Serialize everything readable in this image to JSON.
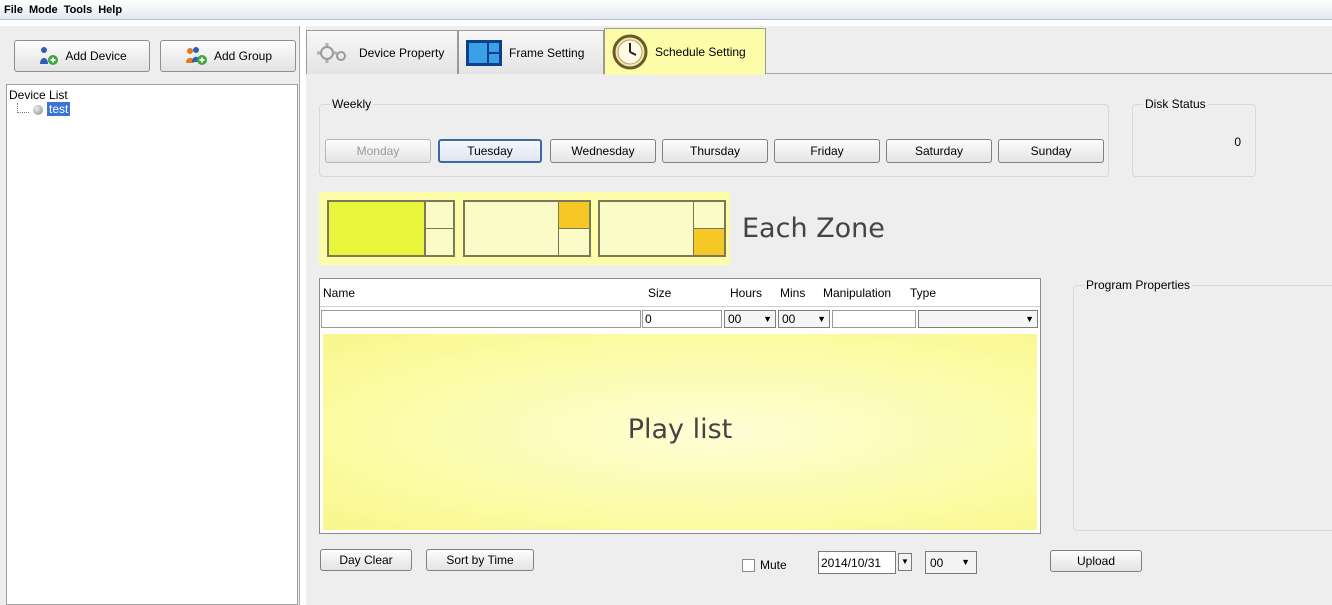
{
  "menu": {
    "items": [
      "File",
      "Mode",
      "Tools",
      "Help"
    ]
  },
  "left": {
    "add_device": "Add Device",
    "add_group": "Add Group",
    "device_list_title": "Device List",
    "devices": [
      "test"
    ]
  },
  "tabs": [
    {
      "label": "Device Property",
      "icon": "gear-icon"
    },
    {
      "label": "Frame Setting",
      "icon": "frame-layout-icon"
    },
    {
      "label": "Schedule Setting",
      "icon": "clock-icon"
    }
  ],
  "weekly": {
    "title": "Weekly",
    "days": [
      "Monday",
      "Tuesday",
      "Wednesday",
      "Thursday",
      "Friday",
      "Saturday",
      "Sunday"
    ],
    "disabled_day": "Monday",
    "selected_day": "Tuesday"
  },
  "disk": {
    "title": "Disk Status",
    "value": "0"
  },
  "zones": {
    "label": "Each Zone"
  },
  "table": {
    "columns": [
      "Name",
      "Size",
      "Hours",
      "Mins",
      "Manipulation",
      "Type"
    ],
    "row": {
      "name": "",
      "size": "0",
      "hours": "00",
      "mins": "00",
      "manipulation": "",
      "type": ""
    },
    "playlist_label": "Play list"
  },
  "program_properties": {
    "title": "Program Properties"
  },
  "bottom": {
    "day_clear": "Day Clear",
    "sort_by_time": "Sort by Time",
    "mute": "Mute",
    "date": "2014/10/31",
    "time": "00",
    "upload": "Upload"
  },
  "colors": {
    "highlight": "#fdfca8",
    "zone_fill": "#e8f53a",
    "zone_gold": "#f5c825",
    "selection": "#3a74d8"
  }
}
